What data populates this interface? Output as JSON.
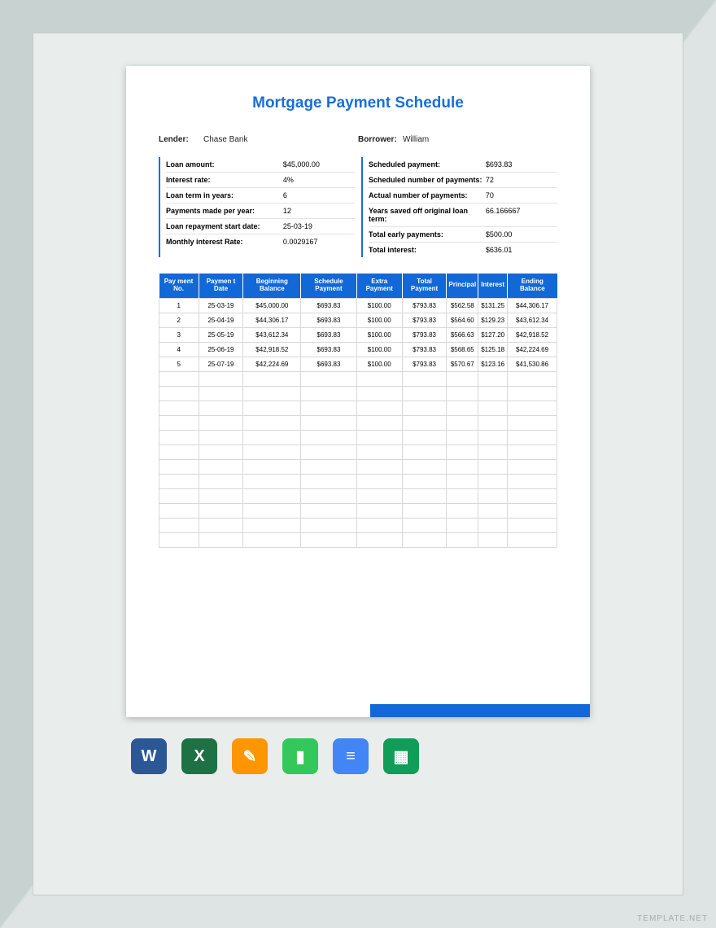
{
  "title": "Mortgage Payment Schedule",
  "parties": {
    "lender_label": "Lender:",
    "lender_value": "Chase Bank",
    "borrower_label": "Borrower:",
    "borrower_value": "William"
  },
  "summary_left": [
    {
      "k": "Loan amount:",
      "v": "$45,000.00"
    },
    {
      "k": "Interest rate:",
      "v": "4%"
    },
    {
      "k": "Loan term in years:",
      "v": "6"
    },
    {
      "k": "Payments made per year:",
      "v": "12"
    },
    {
      "k": "Loan repayment start date:",
      "v": "25-03-19"
    },
    {
      "k": "Monthly interest Rate:",
      "v": "0.0029167"
    }
  ],
  "summary_right": [
    {
      "k": "Scheduled payment:",
      "v": "$693.83"
    },
    {
      "k": "Scheduled number of payments:",
      "v": "72"
    },
    {
      "k": "Actual number of payments:",
      "v": "70"
    },
    {
      "k": "Years saved off original loan term:",
      "v": "66.166667"
    },
    {
      "k": "Total early payments:",
      "v": "$500.00"
    },
    {
      "k": "Total interest:",
      "v": "$636.01"
    }
  ],
  "table": {
    "headers": [
      "Pay ment No.",
      "Paymen t Date",
      "Beginning Balance",
      "Schedule Payment",
      "Extra Payment",
      "Total Payment",
      "Principal",
      "Interest",
      "Ending Balance"
    ],
    "rows": [
      [
        "1",
        "25-03-19",
        "$45,000.00",
        "$693.83",
        "$100.00",
        "$793.83",
        "$562.58",
        "$131.25",
        "$44,306.17"
      ],
      [
        "2",
        "25-04-19",
        "$44,306.17",
        "$693.83",
        "$100.00",
        "$793.83",
        "$564.60",
        "$129.23",
        "$43,612.34"
      ],
      [
        "3",
        "25-05-19",
        "$43,612.34",
        "$693.83",
        "$100.00",
        "$793.83",
        "$566.63",
        "$127.20",
        "$42,918.52"
      ],
      [
        "4",
        "25-06-19",
        "$42,918.52",
        "$693.83",
        "$100.00",
        "$793.83",
        "$568.65",
        "$125.18",
        "$42,224.69"
      ],
      [
        "5",
        "25-07-19",
        "$42,224.69",
        "$693.83",
        "$100.00",
        "$793.83",
        "$570.67",
        "$123.16",
        "$41,530.86"
      ]
    ],
    "empty_rows": 12
  },
  "icons": [
    {
      "name": "ms-word-icon",
      "glyph": "W",
      "class": "icon-word"
    },
    {
      "name": "ms-excel-icon",
      "glyph": "X",
      "class": "icon-excel"
    },
    {
      "name": "apple-pages-icon",
      "glyph": "✎",
      "class": "icon-pages"
    },
    {
      "name": "apple-numbers-icon",
      "glyph": "▮",
      "class": "icon-numbers"
    },
    {
      "name": "google-docs-icon",
      "glyph": "≡",
      "class": "icon-gdocs"
    },
    {
      "name": "google-sheets-icon",
      "glyph": "▦",
      "class": "icon-gsheets"
    }
  ],
  "watermark": "TEMPLATE.NET"
}
